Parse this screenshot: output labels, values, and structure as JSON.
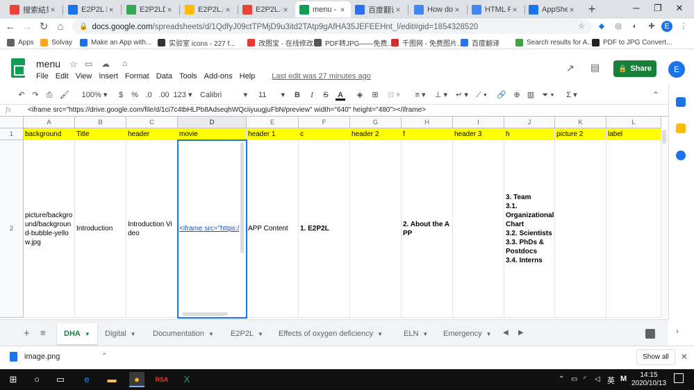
{
  "browser": {
    "tabs": [
      {
        "label": "搜索結果",
        "icon": "gmail-icon",
        "color": "#ea4335"
      },
      {
        "label": "E2P2L Di",
        "icon": "appsheet-icon",
        "color": "#1a73e8"
      },
      {
        "label": "E2P2LDig",
        "icon": "drive-icon",
        "color": "#34a853"
      },
      {
        "label": "E2P2L.mp",
        "icon": "drive-icon",
        "color": "#fbbc04"
      },
      {
        "label": "E2P2L.mp",
        "icon": "slides-icon",
        "color": "#ea4335"
      },
      {
        "label": "menu - G",
        "icon": "sheets-icon",
        "color": "#0f9d58"
      },
      {
        "label": "百度翻译",
        "icon": "translate-icon",
        "color": "#2b6ff5"
      },
      {
        "label": "How do I",
        "icon": "google-icon",
        "color": "#4285f4"
      },
      {
        "label": "HTML Po",
        "icon": "google-icon",
        "color": "#4285f4"
      },
      {
        "label": "AppShee",
        "icon": "appsheet-icon",
        "color": "#1a73e8"
      }
    ],
    "url_host": "docs.google.com",
    "url_path": "/spreadsheets/d/1QdfyJ09ctTPMjD9u3itd2TAtp9gAfHA35JEFEEHnt_l/edit#gid=1854328520",
    "profile_initial": "E",
    "bookmarks": [
      {
        "label": "Apps",
        "color": "#5f6368"
      },
      {
        "label": "Solvay",
        "color": "#f9a825"
      },
      {
        "label": "Make an App with...",
        "color": "#1a73e8"
      },
      {
        "label": "实验室 icons - 227 f...",
        "color": "#333333"
      },
      {
        "label": "改图宝 - 在线修改...",
        "color": "#e53935"
      },
      {
        "label": "PDF转JPG——免费...",
        "color": "#555555"
      },
      {
        "label": "千图网 - 免费图片...",
        "color": "#d32f2f"
      },
      {
        "label": "百度翻译",
        "color": "#2b6ff5"
      },
      {
        "label": "Search results for A...",
        "color": "#43a047"
      },
      {
        "label": "PDF to JPG Convert...",
        "color": "#212121"
      }
    ]
  },
  "sheets": {
    "doc_title": "menu",
    "menus": [
      "File",
      "Edit",
      "View",
      "Insert",
      "Format",
      "Data",
      "Tools",
      "Add-ons",
      "Help"
    ],
    "last_edit": "Last edit was 27 minutes ago",
    "share_label": "Share",
    "user_initial": "E",
    "toolbar": {
      "zoom": "100%",
      "currency": "$",
      "percent": "%",
      "dec_less": ".0",
      "dec_more": ".00",
      "format_more": "123",
      "font": "Calibri",
      "font_size": "11"
    },
    "formula": "<iframe src=\"https://drive.google.com/file/d/1ci7c4tbHLPb8AdseqhWQciiyuugjuFbN/preview\" width=\"640\" height=\"480\"></iframe>",
    "columns": [
      "A",
      "B",
      "C",
      "D",
      "E",
      "F",
      "G",
      "H",
      "I",
      "J",
      "K",
      "L"
    ],
    "row_numbers": [
      "1",
      "2"
    ],
    "header_row": [
      "background",
      "Title",
      "header",
      "movie",
      "header 1",
      "c",
      "header 2",
      "f",
      "header 3",
      "h",
      "picture 2",
      "label"
    ],
    "data_row": [
      "picture/background/background-bubble-yellow.jpg",
      "Introduction",
      "Introduction Video",
      "<iframe src=\"https:/",
      "APP Content",
      "1. E2P2L",
      "",
      "2. About the APP",
      "",
      "3. Team\n3.1. Organizational Chart\n3.2. Scientists\n3.3. PhDs & Postdocs\n3.4. Interns",
      "",
      ""
    ],
    "sheet_tabs": [
      "DHA",
      "Digital",
      "Documentation",
      "E2P2L",
      "Effects of oxygen deficiency",
      "ELN",
      "Emergency"
    ],
    "active_sheet": "DHA",
    "header_fill": "#ffff00"
  },
  "downloads": {
    "file": "image.png",
    "show_all": "Show all"
  },
  "taskbar": {
    "ime": "英",
    "time": "14:15",
    "date": "2020/10/13"
  }
}
